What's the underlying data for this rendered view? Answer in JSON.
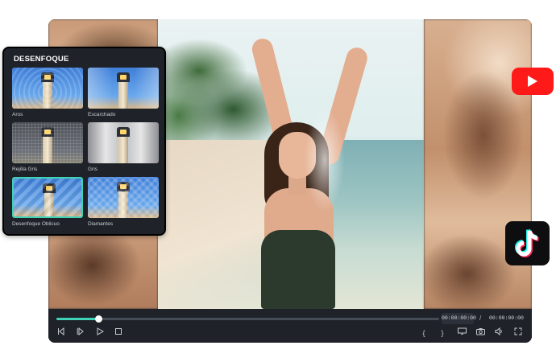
{
  "panel": {
    "title": "DESENFOQUE",
    "effects": [
      {
        "label": "Aros",
        "icon": "lighthouse-aros-thumbnail"
      },
      {
        "label": "Escarchado",
        "icon": "lighthouse-frosted-thumbnail"
      },
      {
        "label": "Rejilla Gris",
        "icon": "lighthouse-gray-grid-thumbnail"
      },
      {
        "label": "Gris",
        "icon": "lighthouse-gray-thumbnail"
      },
      {
        "label": "Desenfoque Oblicuo",
        "icon": "lighthouse-oblique-thumbnail",
        "selected": true
      },
      {
        "label": "Diamantes",
        "icon": "lighthouse-diamonds-thumbnail"
      }
    ]
  },
  "player": {
    "current_time": "00:00:00:00",
    "time_separator": "/",
    "total_time": "00:00:00:00",
    "progress": 0.11
  },
  "controls": {
    "icons": [
      "previous-frame-icon",
      "next-frame-icon",
      "play-icon",
      "stop-icon",
      "mark-in-icon",
      "mark-out-icon",
      "display-icon",
      "snapshot-icon",
      "volume-icon",
      "fullscreen-icon"
    ]
  },
  "colors": {
    "accent": "#3fd2b6",
    "panel_bg": "#1f2329",
    "youtube": "#ff1a1a",
    "tiktok": "#0e0e10"
  }
}
